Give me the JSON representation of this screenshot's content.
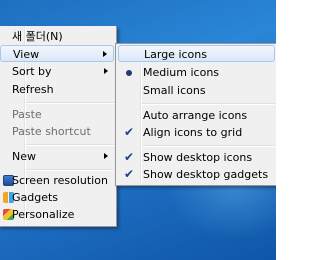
{
  "context_menu": {
    "items": [
      {
        "label": "새 폴더(N)"
      },
      {
        "label": "View"
      },
      {
        "label": "Sort by"
      },
      {
        "label": "Refresh"
      },
      {
        "label": "Paste"
      },
      {
        "label": "Paste shortcut"
      },
      {
        "label": "New"
      },
      {
        "label": "Screen resolution",
        "icon": "screen-resolution-icon"
      },
      {
        "label": "Gadgets",
        "icon": "gadgets-icon"
      },
      {
        "label": "Personalize",
        "icon": "personalize-icon"
      }
    ]
  },
  "view_submenu": {
    "items": [
      {
        "label": "Large icons"
      },
      {
        "label": "Medium icons",
        "state": "selected"
      },
      {
        "label": "Small icons"
      },
      {
        "label": "Auto arrange icons"
      },
      {
        "label": "Align icons to grid",
        "state": "checked"
      },
      {
        "label": "Show desktop icons",
        "state": "checked"
      },
      {
        "label": "Show desktop gadgets",
        "state": "checked"
      }
    ]
  },
  "colors": {
    "desktop_blue": "#2a86d8",
    "menu_background": "#f0f0f0",
    "highlight_border": "#a8c8ec"
  }
}
